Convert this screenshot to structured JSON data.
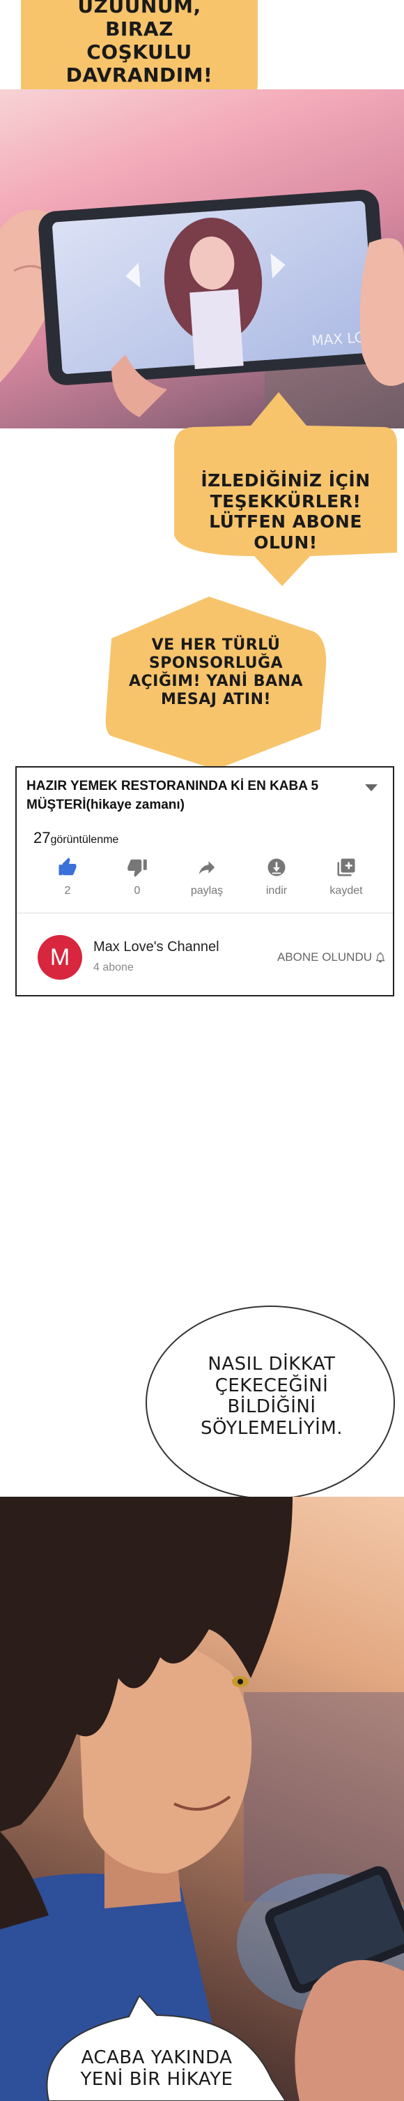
{
  "bubbles": {
    "top": [
      "UZUUNUM,",
      "BIRAZ",
      "COŞKULU",
      "DAVRANDIM!"
    ],
    "thanks": [
      "İZLEDİĞİNİZ İÇİN",
      "TEŞEKKÜRLER!",
      "LÜTFEN ABONE",
      "OLUN!"
    ],
    "sponsor": [
      "VE HER TÜRLÜ",
      "SPONSORLUĞA",
      "AÇIĞIM! YANİ BANA",
      "MESAJ ATIN!"
    ],
    "attention": [
      "NASIL DİKKAT",
      "ÇEKECEĞİNİ",
      "BİLDİĞİNİ",
      "SÖYLEMELİYİM."
    ],
    "bottom": [
      "ACABA YAKINDA",
      "YENİ BİR HİKAYE"
    ]
  },
  "phone_watermark": "MAX LOVE",
  "video": {
    "title": "HAZIR YEMEK RESTORANINDA Kİ EN KABA 5 MÜŞTERİ(hikaye zamanı)",
    "views_count": "27",
    "views_label": "görüntülenme",
    "actions": [
      {
        "icon": "thumbs-up-icon",
        "label": "2"
      },
      {
        "icon": "thumbs-down-icon",
        "label": "0"
      },
      {
        "icon": "share-icon",
        "label": "paylaş"
      },
      {
        "icon": "download-icon",
        "label": "indir"
      },
      {
        "icon": "save-icon",
        "label": "kaydet"
      }
    ],
    "channel_initial": "M",
    "channel_name": "Max Love's Channel",
    "subscribers": "4 abone",
    "subscribe_state": "ABONE OLUNDU"
  },
  "colors": {
    "bubble_orange": "#f7c46c",
    "avatar_red": "#d7263d",
    "like_blue": "#3b6fd9"
  }
}
